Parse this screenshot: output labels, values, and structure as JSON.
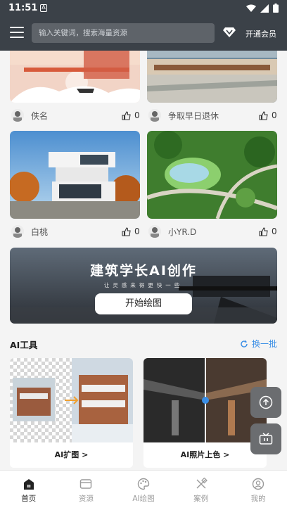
{
  "status": {
    "time": "11:51",
    "sim_label": "A"
  },
  "header": {
    "search_placeholder": "输入关键词，搜索海量资源",
    "vip_label": "开通会员"
  },
  "feed": [
    {
      "author": "佚名",
      "likes": "0"
    },
    {
      "author": "争取早日退休",
      "likes": "0"
    },
    {
      "author": "白桃",
      "likes": "0"
    },
    {
      "author": "小YR.D",
      "likes": "0"
    }
  ],
  "banner": {
    "title": "建筑学长AI创作",
    "subtitle": "让灵感来得更快一些",
    "button": "开始绘图"
  },
  "ai_tools": {
    "title": "AI工具",
    "refresh_label": "换一批",
    "items": [
      {
        "label": "AI扩图 >"
      },
      {
        "label": "AI照片上色 >"
      }
    ]
  },
  "bottom_nav": [
    {
      "label": "首页",
      "icon": "home-icon",
      "active": true
    },
    {
      "label": "资源",
      "icon": "folder-icon",
      "active": false
    },
    {
      "label": "AI绘图",
      "icon": "palette-icon",
      "active": false
    },
    {
      "label": "案例",
      "icon": "design-tools-icon",
      "active": false
    },
    {
      "label": "我的",
      "icon": "profile-icon",
      "active": false
    }
  ],
  "colors": {
    "header_bg": "#3b4148",
    "accent": "#3a8ee6",
    "active_nav": "#222222"
  }
}
